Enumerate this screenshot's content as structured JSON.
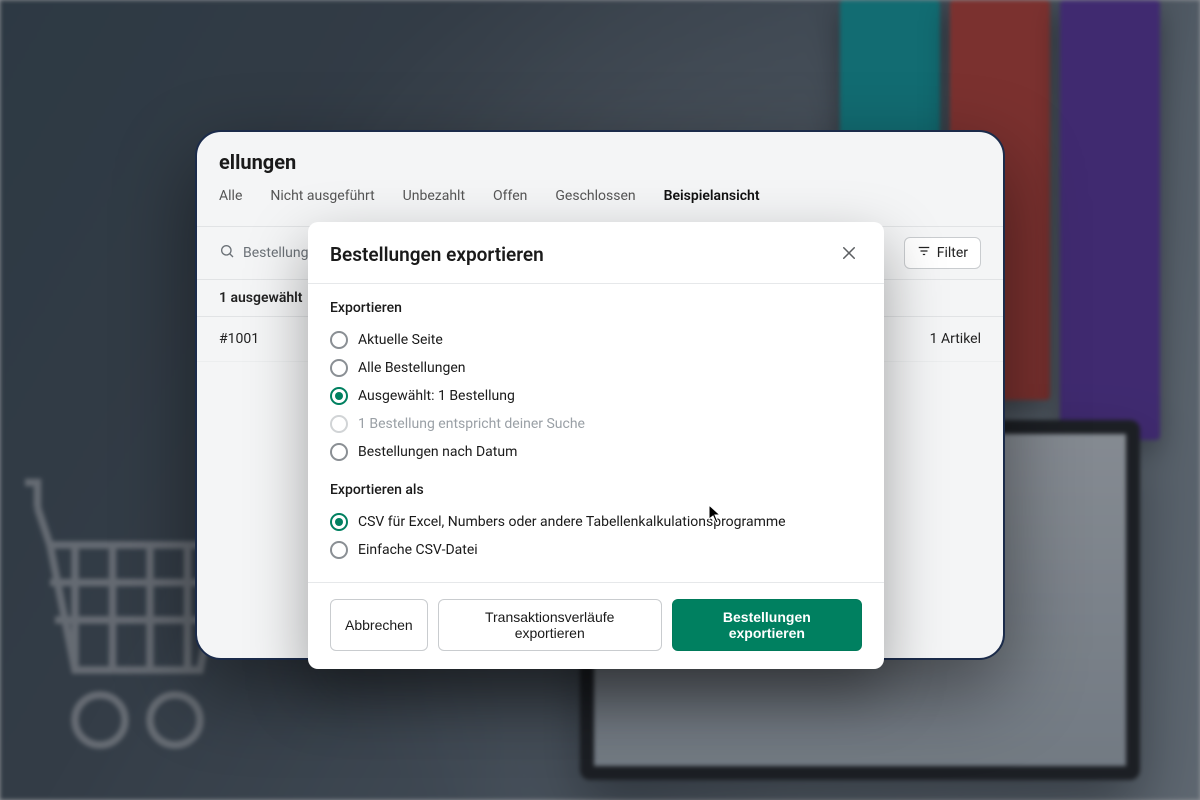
{
  "page": {
    "title": "ellungen",
    "tabs": [
      "Alle",
      "Nicht ausgeführt",
      "Unbezahlt",
      "Offen",
      "Geschlossen",
      "Beispielansicht"
    ],
    "active_tab_index": 5,
    "search_placeholder": "Bestellungen",
    "filter_label": "Filter",
    "selection_text": "1 ausgewählt",
    "order_row": {
      "id": "#1001",
      "items": "1 Artikel"
    }
  },
  "modal": {
    "title": "Bestellungen exportieren",
    "group_export_label": "Exportieren",
    "export_options": [
      {
        "label": "Aktuelle Seite",
        "selected": false,
        "disabled": false
      },
      {
        "label": "Alle Bestellungen",
        "selected": false,
        "disabled": false
      },
      {
        "label": "Ausgewählt: 1 Bestellung",
        "selected": true,
        "disabled": false
      },
      {
        "label": "1 Bestellung entspricht deiner Suche",
        "selected": false,
        "disabled": true
      },
      {
        "label": "Bestellungen nach Datum",
        "selected": false,
        "disabled": false
      }
    ],
    "group_format_label": "Exportieren als",
    "format_options": [
      {
        "label": "CSV für Excel, Numbers oder andere Tabellenkalkulationsprogramme",
        "selected": true
      },
      {
        "label": "Einfache CSV-Datei",
        "selected": false
      }
    ],
    "buttons": {
      "cancel": "Abbrechen",
      "export_transactions": "Transaktionsverläufe exportieren",
      "export_orders": "Bestellungen exportieren"
    }
  }
}
